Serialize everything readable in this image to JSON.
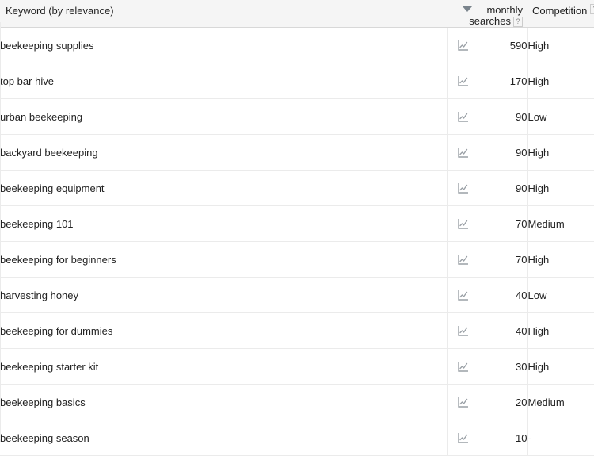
{
  "table": {
    "columns": {
      "keyword": {
        "label": "Keyword (by relevance)",
        "sort_icon": "sort-descending-triangle-icon"
      },
      "searches": {
        "label_line1": "monthly",
        "label_line2": "searches",
        "help_icon": "?"
      },
      "competition": {
        "label": "Competition",
        "help_icon": "?"
      }
    },
    "row_icon": "line-chart-trend-icon",
    "rows": [
      {
        "keyword": "beekeeping supplies",
        "searches": "590",
        "competition": "High"
      },
      {
        "keyword": "top bar hive",
        "searches": "170",
        "competition": "High"
      },
      {
        "keyword": "urban beekeeping",
        "searches": "90",
        "competition": "Low"
      },
      {
        "keyword": "backyard beekeeping",
        "searches": "90",
        "competition": "High"
      },
      {
        "keyword": "beekeeping equipment",
        "searches": "90",
        "competition": "High"
      },
      {
        "keyword": "beekeeping 101",
        "searches": "70",
        "competition": "Medium"
      },
      {
        "keyword": "beekeeping for beginners",
        "searches": "70",
        "competition": "High"
      },
      {
        "keyword": "harvesting honey",
        "searches": "40",
        "competition": "Low"
      },
      {
        "keyword": "beekeeping for dummies",
        "searches": "40",
        "competition": "High"
      },
      {
        "keyword": "beekeeping starter kit",
        "searches": "30",
        "competition": "High"
      },
      {
        "keyword": "beekeeping basics",
        "searches": "20",
        "competition": "Medium"
      },
      {
        "keyword": "beekeeping season",
        "searches": "10",
        "competition": "-"
      }
    ]
  },
  "colors": {
    "header_background": "#f5f5f5",
    "text": "#222222",
    "row_divider": "#ebebeb",
    "header_divider": "#d8d8d8",
    "icon_gray": "#9aa0a6"
  }
}
